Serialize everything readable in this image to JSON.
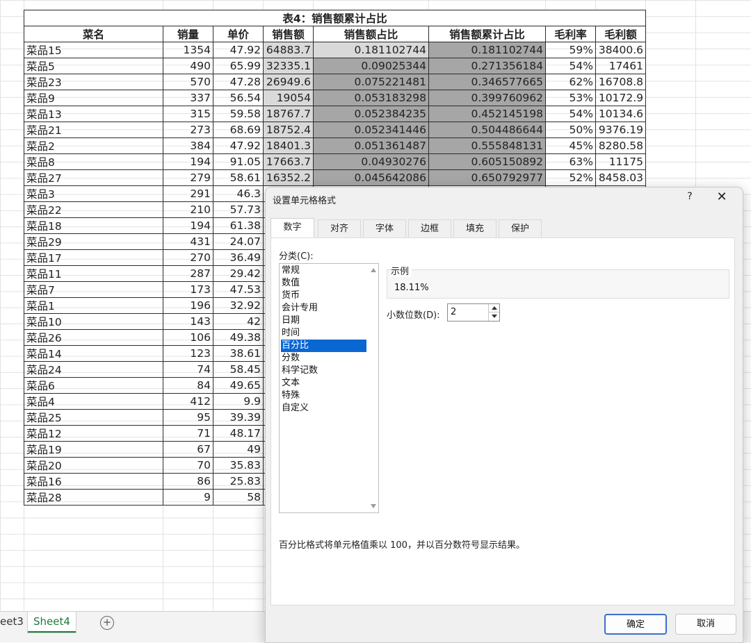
{
  "table": {
    "title": "表4：销售额累计占比",
    "headers": [
      "菜名",
      "销量",
      "单价",
      "销售额",
      "销售额占比",
      "销售额累计占比",
      "毛利率",
      "毛利额"
    ],
    "rows": [
      [
        "菜品15",
        "1354",
        "47.92",
        "64883.7",
        "0.181102744",
        "0.181102744",
        "59%",
        "38400.6"
      ],
      [
        "菜品5",
        "490",
        "65.99",
        "32335.1",
        "0.09025344",
        "0.271356184",
        "54%",
        "17461"
      ],
      [
        "菜品23",
        "570",
        "47.28",
        "26949.6",
        "0.075221481",
        "0.346577665",
        "62%",
        "16708.8"
      ],
      [
        "菜品9",
        "337",
        "56.54",
        "19054",
        "0.053183298",
        "0.399760962",
        "53%",
        "10172.9"
      ],
      [
        "菜品13",
        "315",
        "59.58",
        "18767.7",
        "0.052384235",
        "0.452145198",
        "54%",
        "10134.6"
      ],
      [
        "菜品21",
        "273",
        "68.69",
        "18752.4",
        "0.052341446",
        "0.504486644",
        "50%",
        "9376.19"
      ],
      [
        "菜品2",
        "384",
        "47.92",
        "18401.3",
        "0.051361487",
        "0.555848131",
        "45%",
        "8280.58"
      ],
      [
        "菜品8",
        "194",
        "91.05",
        "17663.7",
        "0.04930276",
        "0.605150892",
        "63%",
        "11175"
      ],
      [
        "菜品27",
        "279",
        "58.61",
        "16352.2",
        "0.045642086",
        "0.650792977",
        "52%",
        "8458.03"
      ],
      [
        "菜品3",
        "291",
        "46.3",
        "",
        "",
        "",
        "",
        ""
      ],
      [
        "菜品22",
        "210",
        "57.73",
        "",
        "",
        "",
        "",
        ""
      ],
      [
        "菜品18",
        "194",
        "61.38",
        "",
        "",
        "",
        "",
        ""
      ],
      [
        "菜品29",
        "431",
        "24.07",
        "",
        "",
        "",
        "",
        ""
      ],
      [
        "菜品17",
        "270",
        "36.49",
        "",
        "",
        "",
        "",
        ""
      ],
      [
        "菜品11",
        "287",
        "29.42",
        "",
        "",
        "",
        "",
        ""
      ],
      [
        "菜品7",
        "173",
        "47.53",
        "",
        "",
        "",
        "",
        ""
      ],
      [
        "菜品1",
        "196",
        "32.92",
        "",
        "",
        "",
        "",
        ""
      ],
      [
        "菜品10",
        "143",
        "42",
        "",
        "",
        "",
        "",
        ""
      ],
      [
        "菜品26",
        "106",
        "49.38",
        "",
        "",
        "",
        "",
        ""
      ],
      [
        "菜品14",
        "123",
        "38.61",
        "",
        "",
        "",
        "",
        ""
      ],
      [
        "菜品24",
        "74",
        "58.45",
        "",
        "",
        "",
        "",
        ""
      ],
      [
        "菜品6",
        "84",
        "49.65",
        "",
        "",
        "",
        "",
        ""
      ],
      [
        "菜品4",
        "412",
        "9.9",
        "",
        "",
        "",
        "",
        ""
      ],
      [
        "菜品25",
        "95",
        "39.39",
        "",
        "",
        "",
        "",
        ""
      ],
      [
        "菜品12",
        "71",
        "48.17",
        "",
        "",
        "",
        "",
        ""
      ],
      [
        "菜品19",
        "67",
        "49",
        "",
        "",
        "",
        "",
        ""
      ],
      [
        "菜品20",
        "70",
        "35.83",
        "",
        "",
        "",
        "",
        ""
      ],
      [
        "菜品16",
        "86",
        "25.83",
        "",
        "",
        "",
        "",
        ""
      ],
      [
        "菜品28",
        "9",
        "58",
        "",
        "",
        "",
        "",
        ""
      ]
    ]
  },
  "sheet_tabs": [
    "eet3",
    "Sheet4"
  ],
  "add_sheet_glyph": "+",
  "dialog": {
    "title": "设置单元格格式",
    "help": "?",
    "close": "✕",
    "tabs": [
      "数字",
      "对齐",
      "字体",
      "边框",
      "填充",
      "保护"
    ],
    "category_label": "分类(C):",
    "categories": [
      "常规",
      "数值",
      "货币",
      "会计专用",
      "日期",
      "时间",
      "百分比",
      "分数",
      "科学记数",
      "文本",
      "特殊",
      "自定义"
    ],
    "selected_category": "百分比",
    "sample_label": "示例",
    "sample_value": "18.11%",
    "decimal_label": "小数位数(D):",
    "decimal_value": "2",
    "description": "百分比格式将单元格值乘以 100，并以百分数符号显示结果。",
    "ok_label": "确定",
    "cancel_label": "取消"
  },
  "colors": {
    "selection_light": "#d9d9d9",
    "selection_dark": "#a6a6a6",
    "active_tab": "#1e7b3c",
    "selected_category_bg": "#0a67d2"
  }
}
